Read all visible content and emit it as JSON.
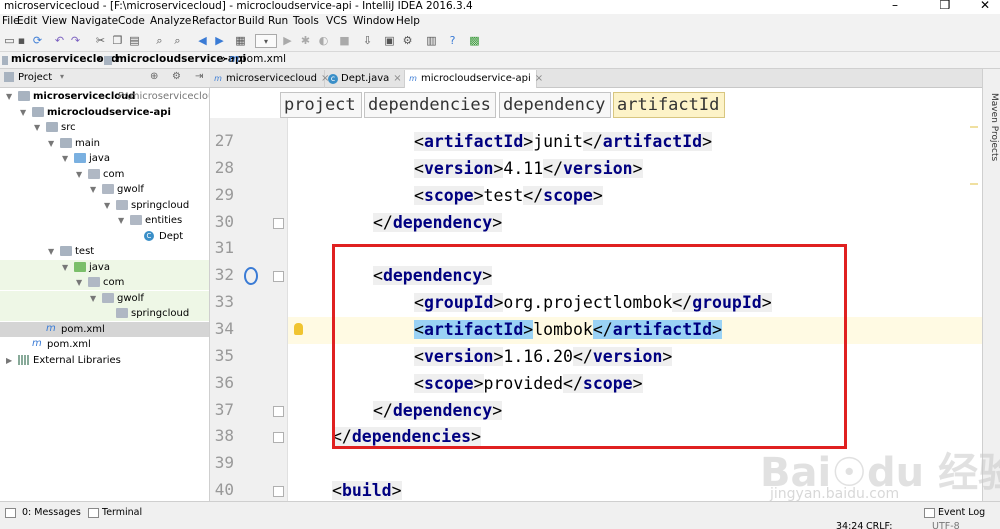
{
  "window": {
    "title": "microservicecloud - [F:\\microservicecloud] - microcloudservice-api - IntelliJ IDEA 2016.3.4",
    "minimize": "–",
    "maximize": "❒",
    "close": "✕"
  },
  "menu": [
    "File",
    "Edit",
    "View",
    "Navigate",
    "Code",
    "Analyze",
    "Refactor",
    "Build",
    "Run",
    "Tools",
    "VCS",
    "Window",
    "Help"
  ],
  "navbar": {
    "crumbs": [
      "microservicecloud",
      "microcloudservice-api",
      "pom.xml"
    ]
  },
  "project_panel": {
    "title": "Project",
    "tree": [
      {
        "label": "microservicecloud",
        "extra": "F:\\microservicecloud",
        "depth": 0,
        "type": "folder",
        "expanded": true
      },
      {
        "label": "microcloudservice-api",
        "depth": 1,
        "type": "folder",
        "expanded": true
      },
      {
        "label": "src",
        "depth": 2,
        "type": "folder",
        "expanded": true
      },
      {
        "label": "main",
        "depth": 3,
        "type": "folder",
        "expanded": true
      },
      {
        "label": "java",
        "depth": 4,
        "type": "folder-blue",
        "expanded": true
      },
      {
        "label": "com",
        "depth": 5,
        "type": "pkg",
        "expanded": true
      },
      {
        "label": "gwolf",
        "depth": 6,
        "type": "pkg",
        "expanded": true
      },
      {
        "label": "springcloud",
        "depth": 7,
        "type": "pkg",
        "expanded": true
      },
      {
        "label": "entities",
        "depth": 8,
        "type": "pkg",
        "expanded": true
      },
      {
        "label": "Dept",
        "depth": 9,
        "type": "class"
      },
      {
        "label": "test",
        "depth": 3,
        "type": "folder",
        "expanded": true
      },
      {
        "label": "java",
        "depth": 4,
        "type": "folder-green",
        "expanded": true
      },
      {
        "label": "com",
        "depth": 5,
        "type": "pkg",
        "expanded": true
      },
      {
        "label": "gwolf",
        "depth": 6,
        "type": "pkg",
        "expanded": true
      },
      {
        "label": "springcloud",
        "depth": 7,
        "type": "pkg"
      },
      {
        "label": "pom.xml",
        "depth": 2,
        "type": "maven",
        "selected": true
      },
      {
        "label": "pom.xml",
        "depth": 1,
        "type": "maven"
      },
      {
        "label": "External Libraries",
        "depth": 0,
        "type": "lib",
        "expanded": false
      }
    ]
  },
  "editor_tabs": [
    {
      "label": "microservicecloud",
      "icon": "m"
    },
    {
      "label": "Dept.java",
      "icon": "c"
    },
    {
      "label": "microcloudservice-api",
      "icon": "m",
      "active": true
    }
  ],
  "breadcrumbs": [
    "project",
    "dependencies",
    "dependency",
    "artifactId"
  ],
  "code_lines": [
    {
      "n": "27",
      "indent": 2,
      "tokens": [
        [
          "t",
          "<"
        ],
        [
          "g",
          "artifactId"
        ],
        [
          "t",
          ">"
        ],
        [
          "x",
          "junit"
        ],
        [
          "t",
          "</"
        ],
        [
          "g",
          "artifactId"
        ],
        [
          "t",
          ">"
        ]
      ]
    },
    {
      "n": "28",
      "indent": 2,
      "tokens": [
        [
          "t",
          "<"
        ],
        [
          "g",
          "version"
        ],
        [
          "t",
          ">"
        ],
        [
          "x",
          "4.11"
        ],
        [
          "t",
          "</"
        ],
        [
          "g",
          "version"
        ],
        [
          "t",
          ">"
        ]
      ]
    },
    {
      "n": "29",
      "indent": 2,
      "tokens": [
        [
          "t",
          "<"
        ],
        [
          "g",
          "scope"
        ],
        [
          "t",
          ">"
        ],
        [
          "x",
          "test"
        ],
        [
          "t",
          "</"
        ],
        [
          "g",
          "scope"
        ],
        [
          "t",
          ">"
        ]
      ]
    },
    {
      "n": "30",
      "indent": 1,
      "tokens": [
        [
          "t",
          "</"
        ],
        [
          "g",
          "dependency"
        ],
        [
          "t",
          ">"
        ]
      ]
    },
    {
      "n": "31",
      "indent": 0,
      "tokens": []
    },
    {
      "n": "32",
      "indent": 1,
      "tokens": [
        [
          "t",
          "<"
        ],
        [
          "g",
          "dependency"
        ],
        [
          "t",
          ">"
        ]
      ]
    },
    {
      "n": "33",
      "indent": 2,
      "tokens": [
        [
          "t",
          "<"
        ],
        [
          "g",
          "groupId"
        ],
        [
          "t",
          ">"
        ],
        [
          "x",
          "org.projectlombok"
        ],
        [
          "t",
          "</"
        ],
        [
          "g",
          "groupId"
        ],
        [
          "t",
          ">"
        ]
      ]
    },
    {
      "n": "34",
      "indent": 2,
      "hl": true,
      "tokens": [
        [
          "s",
          "<"
        ],
        [
          "gs",
          "artifactId"
        ],
        [
          "s",
          ">"
        ],
        [
          "x",
          "lombok"
        ],
        [
          "s",
          "</"
        ],
        [
          "gs",
          "artifactId"
        ],
        [
          "s",
          ">"
        ]
      ]
    },
    {
      "n": "35",
      "indent": 2,
      "tokens": [
        [
          "t",
          "<"
        ],
        [
          "g",
          "version"
        ],
        [
          "t",
          ">"
        ],
        [
          "x",
          "1.16.20"
        ],
        [
          "t",
          "</"
        ],
        [
          "g",
          "version"
        ],
        [
          "t",
          ">"
        ]
      ]
    },
    {
      "n": "36",
      "indent": 2,
      "tokens": [
        [
          "t",
          "<"
        ],
        [
          "g",
          "scope"
        ],
        [
          "t",
          ">"
        ],
        [
          "x",
          "provided"
        ],
        [
          "t",
          "</"
        ],
        [
          "g",
          "scope"
        ],
        [
          "t",
          ">"
        ]
      ]
    },
    {
      "n": "37",
      "indent": 1,
      "tokens": [
        [
          "t",
          "</"
        ],
        [
          "g",
          "dependency"
        ],
        [
          "t",
          ">"
        ]
      ]
    },
    {
      "n": "38",
      "indent": 0,
      "tokens": [
        [
          "t",
          "</"
        ],
        [
          "g",
          "dependencies"
        ],
        [
          "t",
          ">"
        ]
      ]
    },
    {
      "n": "39",
      "indent": 0,
      "tokens": []
    },
    {
      "n": "40",
      "indent": 0,
      "tokens": [
        [
          "t",
          "<"
        ],
        [
          "g",
          "build"
        ],
        [
          "t",
          ">"
        ]
      ]
    }
  ],
  "right_strip": {
    "label": "Maven Projects"
  },
  "status": {
    "messages": "0: Messages",
    "terminal": "Terminal",
    "event_log": "Event Log",
    "position": "34:24",
    "line_sep": "CRLF:",
    "encoding": "UTF-8"
  },
  "watermark": {
    "text": "Bai☉du 经验",
    "url": "jingyan.baidu.com"
  },
  "colors": {
    "tag": "#000080",
    "selection": "#9ad2f5",
    "highlight_line": "#fffae3",
    "annotation_box": "#e02020"
  }
}
